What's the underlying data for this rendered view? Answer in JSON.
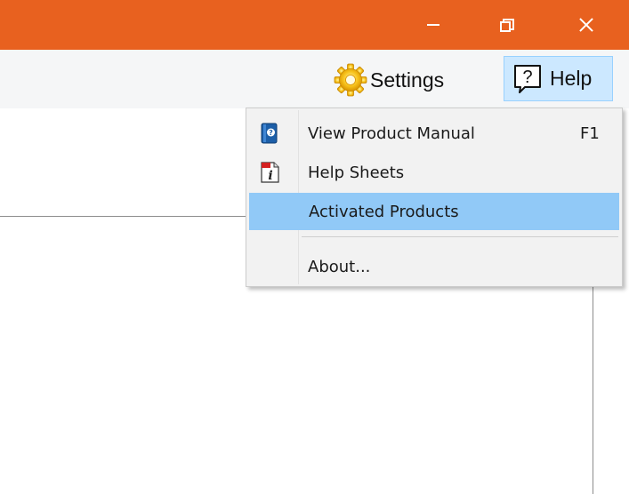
{
  "window": {
    "titlebar_color": "#e8611f"
  },
  "toolbar": {
    "settings_label": "Settings",
    "help_label": "Help",
    "help_icon_text": "?"
  },
  "help_menu": {
    "items": [
      {
        "label": "View Product Manual",
        "shortcut": "F1",
        "icon": "product-manual-book-icon"
      },
      {
        "label": "Help Sheets",
        "shortcut": "",
        "icon": "pdf-info-icon"
      },
      {
        "label": "Activated Products",
        "shortcut": "",
        "icon": "",
        "highlighted": true
      },
      {
        "label": "About...",
        "shortcut": "",
        "icon": ""
      }
    ],
    "highlight_color": "#91c9f7"
  }
}
